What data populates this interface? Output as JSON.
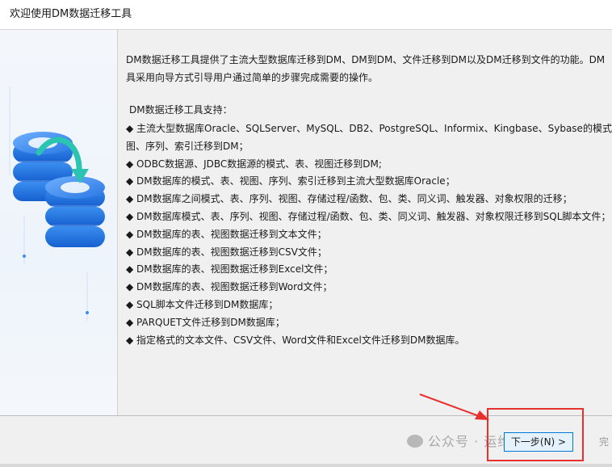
{
  "window": {
    "title": "欢迎使用DM数据迁移工具"
  },
  "intro": [
    "DM数据迁移工具提供了主流大型数据库迁移到DM、DM到DM、文件迁移到DM以及DM迁移到文件的功能。DM",
    "具采用向导方式引导用户通过简单的步骤完成需要的操作。"
  ],
  "support_title": "DM数据迁移工具支持：",
  "features": [
    "◆ 主流大型数据库Oracle、SQLServer、MySQL、DB2、PostgreSQL、Informix、Kingbase、Sybase的模式、",
    "图、序列、索引迁移到DM；",
    "◆ ODBC数据源、JDBC数据源的模式、表、视图迁移到DM;",
    "◆ DM数据库的模式、表、视图、序列、索引迁移到主流大型数据库Oracle；",
    "◆ DM数据库之间模式、表、序列、视图、存储过程/函数、包、类、同义词、触发器、对象权限的迁移；",
    "◆ DM数据库模式、表、序列、视图、存储过程/函数、包、类、同义词、触发器、对象权限迁移到SQL脚本文件；",
    "◆ DM数据库的表、视图数据迁移到文本文件；",
    "◆ DM数据库的表、视图数据迁移到CSV文件；",
    "◆ DM数据库的表、视图数据迁移到Excel文件；",
    "◆ DM数据库的表、视图数据迁移到Word文件；",
    "◆ SQL脚本文件迁移到DM数据库；",
    "◆ PARQUET文件迁移到DM数据库；",
    "◆ 指定格式的文本文件、CSV文件、Word文件和Excel文件迁移到DM数据库。"
  ],
  "buttons": {
    "next": "下一步(N) >",
    "finish": "完"
  },
  "watermark": "公众号 · 运维DevOps",
  "colors": {
    "accent": "#0078d7",
    "highlight": "#e8312f",
    "db_blue": "#1a73e8",
    "arrow_teal": "#2bc4b0"
  },
  "icons": {
    "illustration": "database-migration-icon"
  }
}
